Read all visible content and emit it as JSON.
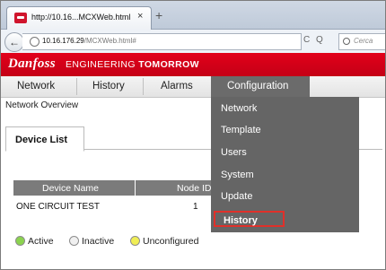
{
  "browser": {
    "tab_title": "http://10.16...MCXWeb.html",
    "tab_close": "×",
    "new_tab": "+",
    "url_host": "10.16.176.29",
    "url_path": "/MCXWeb.html#",
    "search_placeholder": "Cerca",
    "reload_glyph": "C",
    "search_engine_glyph": "Q"
  },
  "brand": {
    "logo": "Danfoss",
    "tagline_prefix": "ENGINEERING ",
    "tagline_bold": "TOMORROW",
    "color": "#e2001a"
  },
  "menu": {
    "items": [
      "Network",
      "History",
      "Alarms",
      "Configuration"
    ],
    "active": "Configuration"
  },
  "page": {
    "heading": "Network Overview",
    "tab_label": "Device List"
  },
  "table": {
    "headers": [
      "Device Name",
      "Node ID"
    ],
    "rows": [
      {
        "device_name": "ONE CIRCUIT TEST",
        "node_id": "1"
      }
    ]
  },
  "legend": {
    "items": [
      {
        "label": "Active",
        "color": "#8bd34f"
      },
      {
        "label": "Inactive",
        "color": "#f0f0f0"
      },
      {
        "label": "Unconfigured",
        "color": "#f0ee55"
      }
    ]
  },
  "dropdown": {
    "items": [
      "Network",
      "Template",
      "Users",
      "System",
      "Update",
      "History"
    ],
    "highlighted": "History",
    "highlight_color": "#e0302a"
  }
}
